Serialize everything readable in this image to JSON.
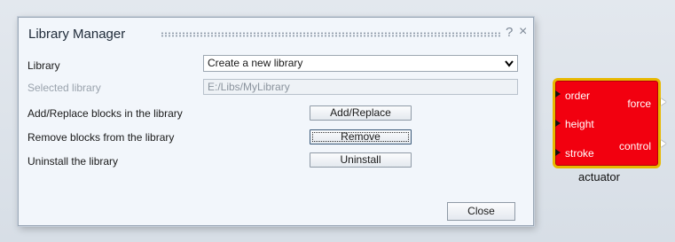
{
  "dialog": {
    "title": "Library Manager",
    "help_label": "?",
    "close_icon": "×",
    "rows": {
      "library_label": "Library",
      "library_value": "Create a new library",
      "selected_label": "Selected library",
      "selected_value": "E:/Libs/MyLibrary",
      "add_label": "Add/Replace blocks in the library",
      "add_button": "Add/Replace",
      "remove_label": "Remove blocks from the library",
      "remove_button": "Remove",
      "uninstall_label": "Uninstall the library",
      "uninstall_button": "Uninstall"
    },
    "close_button": "Close"
  },
  "block": {
    "name": "actuator",
    "inputs": [
      "order",
      "height",
      "stroke"
    ],
    "outputs": [
      "force",
      "control"
    ],
    "fill_color": "#f2000f",
    "border_color": "#e8b800"
  }
}
